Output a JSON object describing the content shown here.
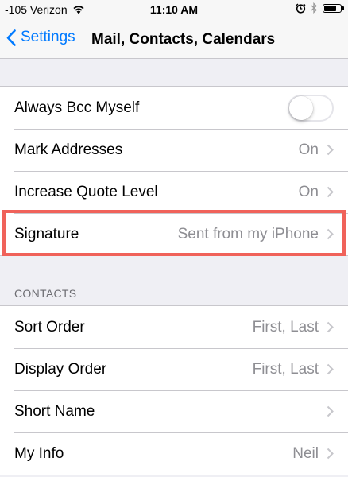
{
  "status": {
    "carrier": "-105 Verizon",
    "time": "11:10 AM"
  },
  "nav": {
    "back_label": "Settings",
    "title": "Mail, Contacts, Calendars"
  },
  "mail_section": {
    "rows": [
      {
        "label": "Always Bcc Myself",
        "toggle_on": false
      },
      {
        "label": "Mark Addresses",
        "value": "On"
      },
      {
        "label": "Increase Quote Level",
        "value": "On"
      },
      {
        "label": "Signature",
        "value": "Sent from my iPhone"
      }
    ]
  },
  "contacts_section": {
    "header": "CONTACTS",
    "rows": [
      {
        "label": "Sort Order",
        "value": "First, Last"
      },
      {
        "label": "Display Order",
        "value": "First, Last"
      },
      {
        "label": "Short Name",
        "value": ""
      },
      {
        "label": "My Info",
        "value": "Neil"
      }
    ]
  },
  "colors": {
    "accent": "#007aff",
    "highlight": "#f0625a",
    "background": "#efeff4"
  },
  "icons": [
    "wifi-icon",
    "alarm-icon",
    "bluetooth-icon",
    "battery-icon",
    "back-chevron-icon",
    "chevron-right-icon"
  ]
}
